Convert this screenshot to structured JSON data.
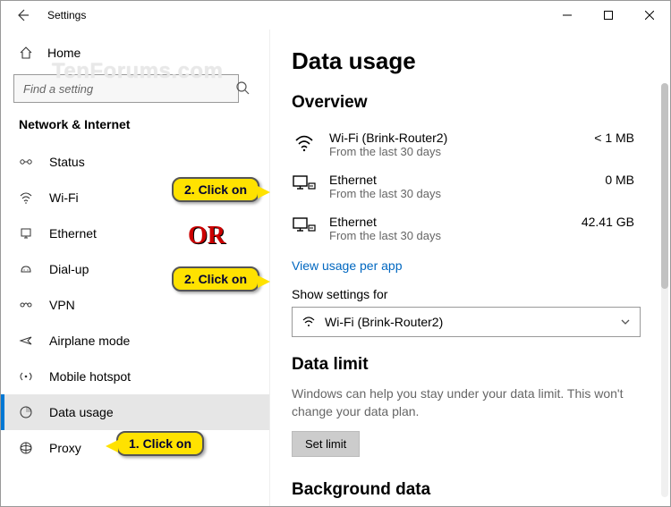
{
  "window": {
    "title": "Settings"
  },
  "watermark": "TenForums.com",
  "home_label": "Home",
  "search": {
    "placeholder": "Find a setting"
  },
  "category": "Network & Internet",
  "nav": [
    {
      "label": "Status"
    },
    {
      "label": "Wi-Fi"
    },
    {
      "label": "Ethernet"
    },
    {
      "label": "Dial-up"
    },
    {
      "label": "VPN"
    },
    {
      "label": "Airplane mode"
    },
    {
      "label": "Mobile hotspot"
    },
    {
      "label": "Data usage"
    },
    {
      "label": "Proxy"
    }
  ],
  "page_title": "Data usage",
  "overview": {
    "heading": "Overview",
    "items": [
      {
        "name": "Wi-Fi (Brink-Router2)",
        "sub": "From the last 30 days",
        "amount": "< 1 MB"
      },
      {
        "name": "Ethernet",
        "sub": "From the last 30 days",
        "amount": "0 MB"
      },
      {
        "name": "Ethernet",
        "sub": "From the last 30 days",
        "amount": "42.41 GB"
      }
    ],
    "link": "View usage per app"
  },
  "show_settings": {
    "label": "Show settings for",
    "selected": "Wi-Fi (Brink-Router2)"
  },
  "data_limit": {
    "heading": "Data limit",
    "desc": "Windows can help you stay under your data limit. This won't change your data plan.",
    "button": "Set limit"
  },
  "background": {
    "heading": "Background data"
  },
  "annotations": {
    "step1": "1. Click on",
    "step2a": "2. Click on",
    "step2b": "2. Click on",
    "or": "OR"
  }
}
